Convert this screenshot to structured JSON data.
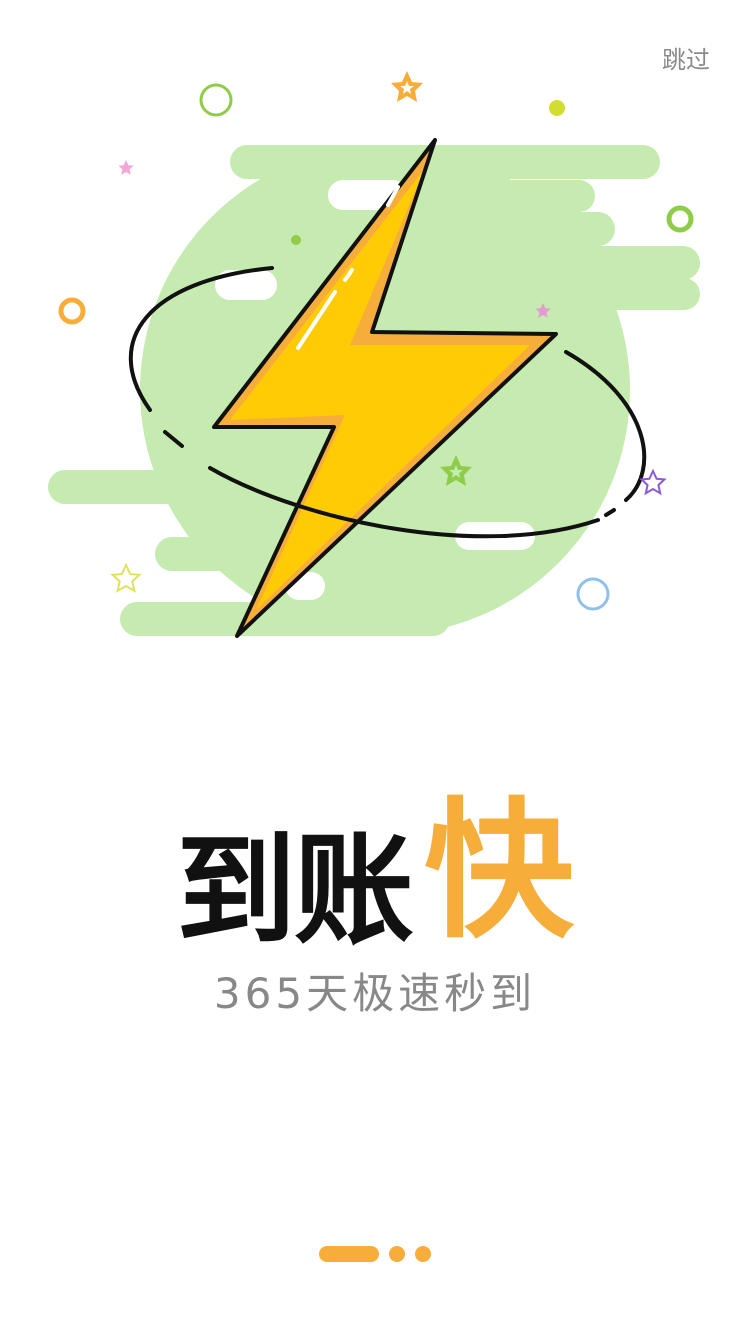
{
  "skip_label": "跳过",
  "headline": {
    "prefix": "到账",
    "accent": "快"
  },
  "subtitle": "365天极速秒到",
  "pager": {
    "count": 3,
    "active_index": 0
  },
  "colors": {
    "accent": "#f7ad3a",
    "bolt": "#ffcb05",
    "blob": "#c6ebb0",
    "text_dark": "#111111",
    "text_gray": "#888888"
  },
  "icons": [
    "lightning-bolt-icon",
    "star-icon",
    "circle-icon"
  ]
}
